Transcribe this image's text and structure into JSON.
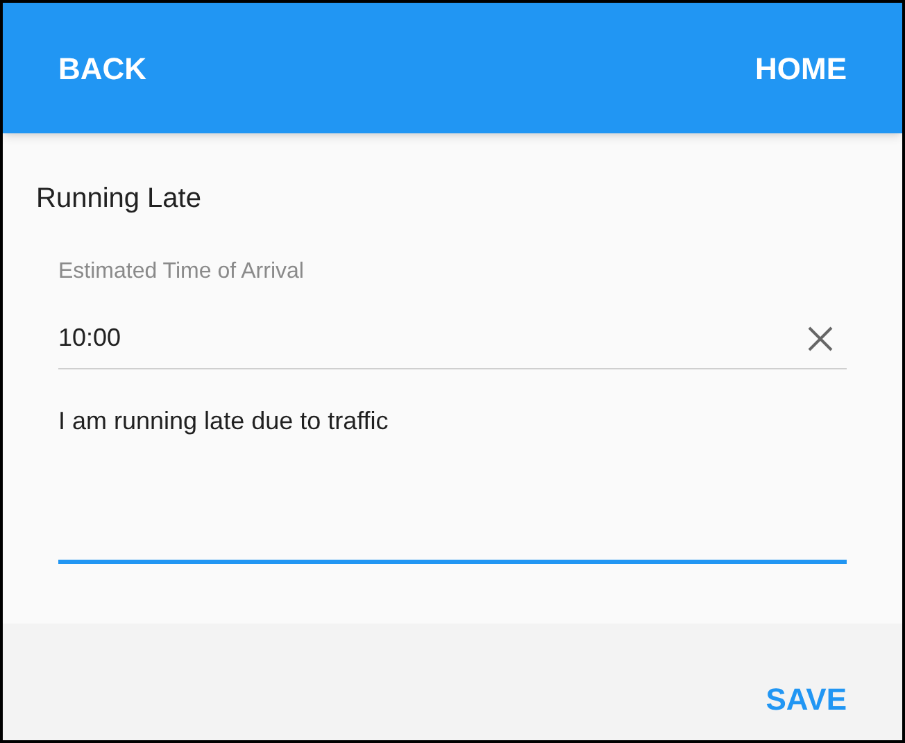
{
  "header": {
    "back": "BACK",
    "home": "HOME"
  },
  "title": "Running Late",
  "eta_field": {
    "label": "Estimated Time of Arrival",
    "value": "10:00"
  },
  "message_field": {
    "value": "I am running late due to traffic",
    "focused": true
  },
  "footer": {
    "save": "SAVE"
  }
}
